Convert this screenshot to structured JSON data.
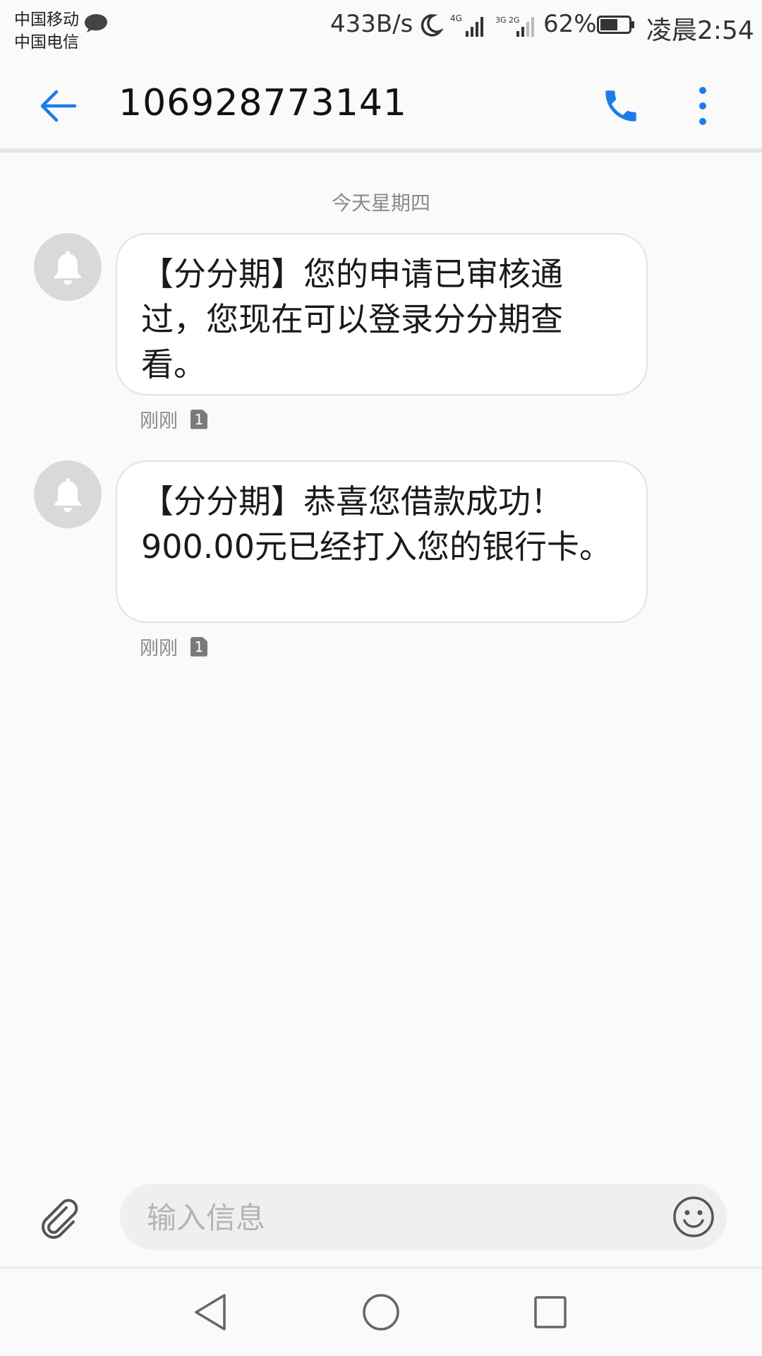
{
  "status_bar": {
    "carrier_1": "中国移动",
    "carrier_2": "中国电信",
    "net_speed": "433B/s",
    "network_1": "4G",
    "network_2": "3G 2G",
    "battery_percent": "62%",
    "battery_level": 0.62,
    "time": "凌晨2:54"
  },
  "app_bar": {
    "title": "106928773141",
    "icons": [
      "back-arrow-icon",
      "phone-icon",
      "more-vert-icon"
    ]
  },
  "conversation": {
    "day_divider": "今天星期四",
    "messages": [
      {
        "text": "【分分期】您的申请已审核通过，您现在可以登录分分期查看。",
        "time": "刚刚",
        "sim": "1"
      },
      {
        "text": "【分分期】恭喜您借款成功！900.00元已经打入您的银行卡。",
        "time": "刚刚",
        "sim": "1"
      }
    ]
  },
  "compose": {
    "placeholder": "输入信息",
    "icons": [
      "paperclip-icon",
      "emoji-icon"
    ]
  },
  "nav_bar": {
    "icons": [
      "nav-back-icon",
      "nav-home-icon",
      "nav-recent-icon"
    ]
  },
  "colors": {
    "accent": "#1a7ee6",
    "background": "#fafafa",
    "bubble": "#ffffff",
    "avatar": "#d9d9d9"
  }
}
